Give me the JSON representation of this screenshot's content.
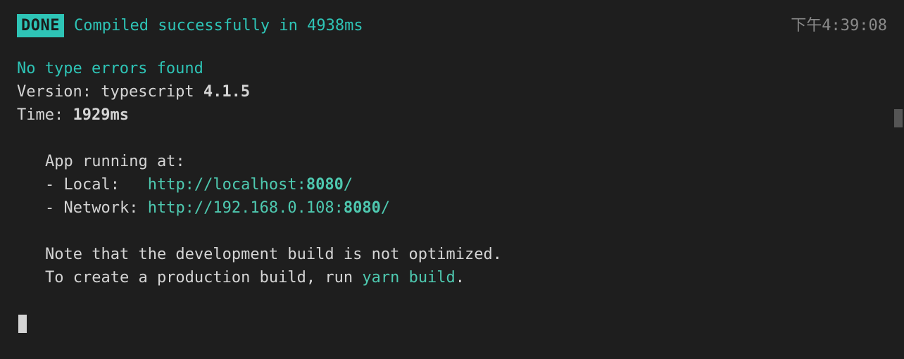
{
  "header": {
    "badge": " DONE ",
    "message": "Compiled successfully in 4938ms",
    "timestamp": "下午4:39:08"
  },
  "typecheck": {
    "no_errors": "No type errors found",
    "version_label": "Version: ",
    "version_name": "typescript ",
    "version_number": "4.1.5",
    "time_label": "Time: ",
    "time_value": "1929ms"
  },
  "running": {
    "title": "App running at:",
    "local_label": "- Local:   ",
    "local_host": "http://localhost:",
    "local_port": "8080",
    "local_slash": "/",
    "network_label": "- Network: ",
    "network_host": "http://192.168.0.108:",
    "network_port": "8080",
    "network_slash": "/"
  },
  "note": {
    "line1": "Note that the development build is not optimized.",
    "line2_prefix": "To create a production build, run ",
    "line2_cmd": "yarn build",
    "line2_suffix": "."
  }
}
